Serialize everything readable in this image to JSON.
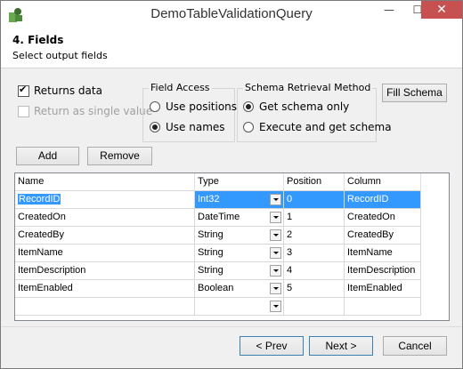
{
  "window": {
    "title": "DemoTableValidationQuery",
    "minimize": "—",
    "maximize": "☐",
    "close": "✕"
  },
  "header": {
    "step_title": "4. Fields",
    "subtitle": "Select output fields"
  },
  "options": {
    "returns_data": {
      "label": "Returns data",
      "checked": true
    },
    "single_value": {
      "label": "Return as single value",
      "checked": false,
      "disabled": true
    }
  },
  "field_access": {
    "title": "Field Access",
    "options": [
      {
        "label": "Use positions",
        "selected": false
      },
      {
        "label": "Use names",
        "selected": true
      }
    ]
  },
  "schema_retrieval": {
    "title": "Schema Retrieval Method",
    "options": [
      {
        "label": "Get schema only",
        "selected": true
      },
      {
        "label": "Execute and get schema",
        "selected": false
      }
    ]
  },
  "buttons": {
    "fill_schema": "Fill Schema",
    "add": "Add",
    "remove": "Remove",
    "prev": "< Prev",
    "next": "Next >",
    "cancel": "Cancel"
  },
  "grid": {
    "columns": [
      "Name",
      "Type",
      "Position",
      "Column"
    ],
    "rows": [
      {
        "name": "RecordID",
        "type": "Int32",
        "position": "0",
        "column": "RecordID"
      },
      {
        "name": "CreatedOn",
        "type": "DateTime",
        "position": "1",
        "column": "CreatedOn"
      },
      {
        "name": "CreatedBy",
        "type": "String",
        "position": "2",
        "column": "CreatedBy"
      },
      {
        "name": "ItemName",
        "type": "String",
        "position": "3",
        "column": "ItemName"
      },
      {
        "name": "ItemDescription",
        "type": "String",
        "position": "4",
        "column": "ItemDescription"
      },
      {
        "name": "ItemEnabled",
        "type": "Boolean",
        "position": "5",
        "column": "ItemEnabled"
      }
    ],
    "selected_row": 0
  },
  "colors": {
    "selection": "#3399ff",
    "close_button": "#c75050"
  }
}
